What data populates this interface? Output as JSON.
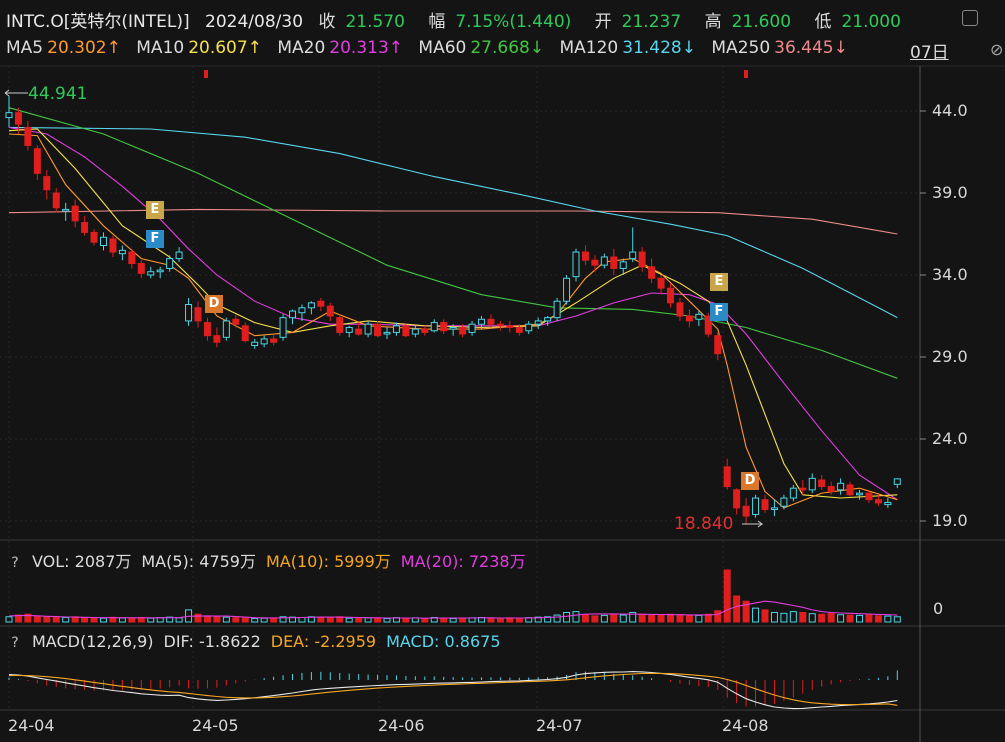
{
  "header": {
    "symbol": "INTC.O[英特尔(INTEL)]",
    "date": "2024/08/30",
    "close_label": "收",
    "close": "21.570",
    "change_label": "幅",
    "change": "7.15%(1.440)",
    "open_label": "开",
    "open": "21.237",
    "high_label": "高",
    "high": "21.600",
    "low_label": "低",
    "low": "21.000"
  },
  "ma_legend": [
    {
      "label": "MA5",
      "value": "20.302↑",
      "color": "#ff9a2e"
    },
    {
      "label": "MA10",
      "value": "20.607↑",
      "color": "#f5e14a"
    },
    {
      "label": "MA20",
      "value": "20.313↑",
      "color": "#e23de0"
    },
    {
      "label": "MA60",
      "value": "27.668↓",
      "color": "#41c741"
    },
    {
      "label": "MA120",
      "value": "31.428↓",
      "color": "#58d6ee"
    },
    {
      "label": "MA250",
      "value": "36.445↓",
      "color": "#f08a8a"
    }
  ],
  "period": "07日",
  "annotations": {
    "high_mark": "44.941",
    "low_mark": "18.840"
  },
  "volume_panel": {
    "q": "?",
    "vol": "VOL: 2087万",
    "ma5": "MA(5): 4759万",
    "ma10": "MA(10): 5999万",
    "ma20": "MA(20): 7238万",
    "zero_label": "0"
  },
  "macd_panel": {
    "q": "?",
    "title": "MACD(12,26,9)",
    "dif": "DIF: -1.8622",
    "dea": "DEA: -2.2959",
    "macd": "MACD: 0.8675"
  },
  "badges": [
    {
      "text": "E",
      "color": "#c9a64a"
    },
    {
      "text": "F",
      "color": "#2a8bc7"
    },
    {
      "text": "D",
      "color": "#d9782a"
    },
    {
      "text": "E",
      "color": "#c9a64a"
    },
    {
      "text": "F",
      "color": "#2a8bc7"
    },
    {
      "text": "D",
      "color": "#d9782a"
    }
  ],
  "chart_data": {
    "type": "candlestick",
    "x_tick_labels": [
      "24-04",
      "24-05",
      "24-06",
      "24-07",
      "24-08"
    ],
    "y_tick_labels": [
      "44.0",
      "39.0",
      "34.0",
      "29.0",
      "24.0",
      "19.0"
    ],
    "ylim": [
      18.3,
      46.0
    ],
    "colors": {
      "up": "#4ad6e6",
      "down": "#e01e1e",
      "volume_ma": "#e23de0"
    },
    "ohlc": [
      [
        43.6,
        44.94,
        43.0,
        43.9
      ],
      [
        43.9,
        44.2,
        42.6,
        43.2
      ],
      [
        43.0,
        43.4,
        41.6,
        41.9
      ],
      [
        41.7,
        41.9,
        39.8,
        40.2
      ],
      [
        40.0,
        40.4,
        38.6,
        39.2
      ],
      [
        39.0,
        39.3,
        37.8,
        38.1
      ],
      [
        37.9,
        38.4,
        37.3,
        38.0
      ],
      [
        38.2,
        38.6,
        36.9,
        37.3
      ],
      [
        37.2,
        37.6,
        36.4,
        36.6
      ],
      [
        36.6,
        36.8,
        35.8,
        36.0
      ],
      [
        35.8,
        36.6,
        35.5,
        36.3
      ],
      [
        36.2,
        36.4,
        35.1,
        35.4
      ],
      [
        35.3,
        35.8,
        34.9,
        35.5
      ],
      [
        35.4,
        35.6,
        34.4,
        34.7
      ],
      [
        34.7,
        34.9,
        33.8,
        34.1
      ],
      [
        34.0,
        34.5,
        33.8,
        34.2
      ],
      [
        34.2,
        34.5,
        33.8,
        34.3
      ],
      [
        34.4,
        35.2,
        34.2,
        35.0
      ],
      [
        35.0,
        35.7,
        34.8,
        35.4
      ],
      [
        31.2,
        32.6,
        30.9,
        32.2
      ],
      [
        32.0,
        32.4,
        30.8,
        31.2
      ],
      [
        31.1,
        31.4,
        30.0,
        30.3
      ],
      [
        30.3,
        30.8,
        29.6,
        29.9
      ],
      [
        30.2,
        31.4,
        30.0,
        31.2
      ],
      [
        31.3,
        31.6,
        30.8,
        31.0
      ],
      [
        30.9,
        31.1,
        29.9,
        30.0
      ],
      [
        29.7,
        30.1,
        29.5,
        29.9
      ],
      [
        29.8,
        30.3,
        29.6,
        30.1
      ],
      [
        30.1,
        30.4,
        29.7,
        29.9
      ],
      [
        30.2,
        31.6,
        30.0,
        31.4
      ],
      [
        31.4,
        31.9,
        31.0,
        31.8
      ],
      [
        31.7,
        32.2,
        31.2,
        32.0
      ],
      [
        32.0,
        32.4,
        31.6,
        32.3
      ],
      [
        32.4,
        32.6,
        31.8,
        32.1
      ],
      [
        32.1,
        32.3,
        31.2,
        31.5
      ],
      [
        31.4,
        31.6,
        30.3,
        30.5
      ],
      [
        30.5,
        30.9,
        30.2,
        30.8
      ],
      [
        30.7,
        31.1,
        30.3,
        30.4
      ],
      [
        30.4,
        31.2,
        30.2,
        31.0
      ],
      [
        31.0,
        31.2,
        30.2,
        30.3
      ],
      [
        30.4,
        30.8,
        30.1,
        30.5
      ],
      [
        30.5,
        31.1,
        30.3,
        30.9
      ],
      [
        30.9,
        31.0,
        30.2,
        30.3
      ],
      [
        30.4,
        30.9,
        30.2,
        30.7
      ],
      [
        30.7,
        30.9,
        30.3,
        30.5
      ],
      [
        30.6,
        31.3,
        30.5,
        31.1
      ],
      [
        31.1,
        31.3,
        30.4,
        30.6
      ],
      [
        30.7,
        31.0,
        30.3,
        30.8
      ],
      [
        30.8,
        31.0,
        30.2,
        30.4
      ],
      [
        30.5,
        31.2,
        30.3,
        31.0
      ],
      [
        31.0,
        31.5,
        30.7,
        31.3
      ],
      [
        31.3,
        31.6,
        30.8,
        31.0
      ],
      [
        31.0,
        31.2,
        30.6,
        30.9
      ],
      [
        30.9,
        31.2,
        30.5,
        30.8
      ],
      [
        30.8,
        31.0,
        30.3,
        30.5
      ],
      [
        30.6,
        31.2,
        30.4,
        31.0
      ],
      [
        31.0,
        31.4,
        30.7,
        31.2
      ],
      [
        31.2,
        31.5,
        30.9,
        31.4
      ],
      [
        31.4,
        32.6,
        31.2,
        32.4
      ],
      [
        32.4,
        34.0,
        32.2,
        33.8
      ],
      [
        33.9,
        35.6,
        33.6,
        35.4
      ],
      [
        35.4,
        35.8,
        34.6,
        34.9
      ],
      [
        34.9,
        35.2,
        34.2,
        34.6
      ],
      [
        34.6,
        35.3,
        34.4,
        35.1
      ],
      [
        35.1,
        35.6,
        34.0,
        34.4
      ],
      [
        34.4,
        35.0,
        34.0,
        34.8
      ],
      [
        35.0,
        36.9,
        34.8,
        35.4
      ],
      [
        35.4,
        35.7,
        34.2,
        34.5
      ],
      [
        34.5,
        35.0,
        33.5,
        33.8
      ],
      [
        33.8,
        34.0,
        32.8,
        33.2
      ],
      [
        33.2,
        33.5,
        32.0,
        32.3
      ],
      [
        32.3,
        32.6,
        31.2,
        31.5
      ],
      [
        31.5,
        31.9,
        30.8,
        31.2
      ],
      [
        31.3,
        31.8,
        30.9,
        31.6
      ],
      [
        31.5,
        31.7,
        30.2,
        30.4
      ],
      [
        30.3,
        30.5,
        28.8,
        29.2
      ],
      [
        22.3,
        22.8,
        20.9,
        21.1
      ],
      [
        20.9,
        21.0,
        19.4,
        19.8
      ],
      [
        19.9,
        20.4,
        18.84,
        19.3
      ],
      [
        19.4,
        20.6,
        19.2,
        20.4
      ],
      [
        20.3,
        20.6,
        19.5,
        19.7
      ],
      [
        19.7,
        20.3,
        19.3,
        19.8
      ],
      [
        19.9,
        20.6,
        19.7,
        20.4
      ],
      [
        20.4,
        21.2,
        20.2,
        21.0
      ],
      [
        21.0,
        21.5,
        20.6,
        20.9
      ],
      [
        20.9,
        21.9,
        20.7,
        21.6
      ],
      [
        21.5,
        21.8,
        20.9,
        21.1
      ],
      [
        21.1,
        21.4,
        20.6,
        20.8
      ],
      [
        20.9,
        21.6,
        20.6,
        21.3
      ],
      [
        21.2,
        21.4,
        20.5,
        20.6
      ],
      [
        20.6,
        20.9,
        20.3,
        20.7
      ],
      [
        20.7,
        20.9,
        20.1,
        20.3
      ],
      [
        20.3,
        20.6,
        19.9,
        20.1
      ],
      [
        20.0,
        20.4,
        19.8,
        20.13
      ],
      [
        21.237,
        21.6,
        21.0,
        21.57
      ]
    ],
    "volume_scale": [
      0,
      300
    ],
    "volumes": [
      30,
      40,
      45,
      35,
      30,
      28,
      26,
      30,
      25,
      24,
      22,
      27,
      23,
      24,
      26,
      22,
      25,
      28,
      24,
      70,
      45,
      35,
      30,
      28,
      25,
      22,
      20,
      22,
      24,
      30,
      28,
      26,
      30,
      25,
      28,
      30,
      22,
      20,
      24,
      22,
      20,
      25,
      22,
      24,
      20,
      26,
      22,
      20,
      22,
      24,
      26,
      22,
      20,
      24,
      22,
      25,
      28,
      30,
      40,
      55,
      60,
      42,
      35,
      38,
      45,
      40,
      55,
      42,
      38,
      40,
      45,
      42,
      35,
      38,
      45,
      65,
      300,
      150,
      120,
      80,
      70,
      55,
      50,
      60,
      55,
      48,
      45,
      50,
      42,
      40,
      38,
      42,
      36,
      34,
      30
    ],
    "volume_ma": [
      35,
      37,
      38,
      36,
      33,
      31,
      29,
      28,
      27,
      26,
      25,
      25,
      25,
      24,
      24,
      24,
      24,
      25,
      25,
      33,
      34,
      35,
      34,
      34,
      31,
      28,
      25,
      24,
      23,
      24,
      25,
      26,
      27,
      28,
      28,
      28,
      27,
      26,
      25,
      24,
      23,
      23,
      23,
      23,
      22,
      23,
      23,
      23,
      23,
      23,
      24,
      24,
      23,
      23,
      23,
      23,
      24,
      26,
      29,
      33,
      40,
      45,
      47,
      47,
      47,
      46,
      45,
      45,
      44,
      43,
      42,
      42,
      41,
      41,
      41,
      43,
      70,
      90,
      100,
      110,
      120,
      115,
      105,
      95,
      85,
      70,
      60,
      55,
      52,
      50,
      48,
      46,
      44,
      42,
      40
    ],
    "macd": {
      "dif": [
        0.5,
        0.45,
        0.35,
        0.2,
        0.05,
        -0.1,
        -0.25,
        -0.4,
        -0.55,
        -0.7,
        -0.82,
        -0.95,
        -1.05,
        -1.15,
        -1.25,
        -1.32,
        -1.38,
        -1.4,
        -1.38,
        -1.6,
        -1.72,
        -1.8,
        -1.85,
        -1.82,
        -1.76,
        -1.7,
        -1.62,
        -1.52,
        -1.42,
        -1.3,
        -1.18,
        -1.05,
        -0.92,
        -0.82,
        -0.75,
        -0.7,
        -0.65,
        -0.6,
        -0.55,
        -0.5,
        -0.46,
        -0.42,
        -0.4,
        -0.37,
        -0.34,
        -0.3,
        -0.28,
        -0.26,
        -0.24,
        -0.22,
        -0.18,
        -0.15,
        -0.12,
        -0.1,
        -0.08,
        -0.04,
        0.0,
        0.05,
        0.12,
        0.25,
        0.45,
        0.58,
        0.65,
        0.7,
        0.72,
        0.73,
        0.76,
        0.74,
        0.68,
        0.6,
        0.5,
        0.38,
        0.25,
        0.15,
        0.02,
        -0.2,
        -0.75,
        -1.25,
        -1.7,
        -2.0,
        -2.25,
        -2.45,
        -2.55,
        -2.6,
        -2.58,
        -2.52,
        -2.45,
        -2.4,
        -2.33,
        -2.28,
        -2.22,
        -2.17,
        -2.1,
        -2.0,
        -1.8622
      ],
      "dea": [
        0.4,
        0.41,
        0.4,
        0.36,
        0.3,
        0.22,
        0.13,
        0.02,
        -0.1,
        -0.22,
        -0.34,
        -0.46,
        -0.58,
        -0.69,
        -0.8,
        -0.9,
        -0.99,
        -1.07,
        -1.13,
        -1.22,
        -1.32,
        -1.42,
        -1.5,
        -1.57,
        -1.61,
        -1.63,
        -1.63,
        -1.61,
        -1.57,
        -1.52,
        -1.45,
        -1.37,
        -1.28,
        -1.19,
        -1.1,
        -1.02,
        -0.94,
        -0.87,
        -0.8,
        -0.74,
        -0.68,
        -0.63,
        -0.58,
        -0.54,
        -0.5,
        -0.46,
        -0.42,
        -0.39,
        -0.36,
        -0.33,
        -0.3,
        -0.27,
        -0.24,
        -0.21,
        -0.18,
        -0.15,
        -0.12,
        -0.08,
        -0.04,
        0.02,
        0.1,
        0.2,
        0.29,
        0.37,
        0.44,
        0.5,
        0.55,
        0.59,
        0.6,
        0.6,
        0.58,
        0.54,
        0.48,
        0.42,
        0.34,
        0.24,
        0.05,
        -0.2,
        -0.5,
        -0.8,
        -1.09,
        -1.36,
        -1.6,
        -1.8,
        -1.96,
        -2.07,
        -2.15,
        -2.2,
        -2.23,
        -2.24,
        -2.24,
        -2.23,
        -2.2,
        -2.17,
        -2.2959
      ]
    },
    "ma_series_approx": {
      "ma5": [
        [
          0,
          42.6
        ],
        [
          3,
          42.5
        ],
        [
          6,
          39.5
        ],
        [
          10,
          37.0
        ],
        [
          14,
          35.0
        ],
        [
          17,
          34.6
        ],
        [
          19,
          33.8
        ],
        [
          22,
          31.5
        ],
        [
          26,
          30.3
        ],
        [
          30,
          30.5
        ],
        [
          34,
          31.8
        ],
        [
          38,
          30.9
        ],
        [
          44,
          30.7
        ],
        [
          50,
          30.7
        ],
        [
          56,
          31.0
        ],
        [
          58,
          31.6
        ],
        [
          61,
          33.8
        ],
        [
          63,
          34.8
        ],
        [
          66,
          35.0
        ],
        [
          69,
          34.1
        ],
        [
          72,
          32.4
        ],
        [
          75,
          30.7
        ],
        [
          76,
          28.5
        ],
        [
          78,
          23.5
        ],
        [
          80,
          20.8
        ],
        [
          82,
          19.8
        ],
        [
          86,
          20.7
        ],
        [
          90,
          21.0
        ],
        [
          94,
          20.3
        ]
      ],
      "ma10": [
        [
          0,
          42.8
        ],
        [
          3,
          42.9
        ],
        [
          7,
          40.5
        ],
        [
          12,
          37.0
        ],
        [
          17,
          35.1
        ],
        [
          20,
          33.4
        ],
        [
          22,
          32.2
        ],
        [
          26,
          31.1
        ],
        [
          30,
          30.5
        ],
        [
          34,
          30.9
        ],
        [
          38,
          31.2
        ],
        [
          44,
          30.9
        ],
        [
          50,
          30.8
        ],
        [
          56,
          30.9
        ],
        [
          60,
          32.3
        ],
        [
          64,
          33.8
        ],
        [
          67,
          34.6
        ],
        [
          71,
          33.5
        ],
        [
          74,
          32.4
        ],
        [
          76,
          31.2
        ],
        [
          78,
          28.5
        ],
        [
          80,
          25.5
        ],
        [
          82,
          22.5
        ],
        [
          84,
          20.6
        ],
        [
          88,
          20.4
        ],
        [
          94,
          20.6
        ]
      ],
      "ma20": [
        [
          0,
          43.0
        ],
        [
          4,
          42.6
        ],
        [
          8,
          41.2
        ],
        [
          12,
          39.4
        ],
        [
          16,
          37.4
        ],
        [
          19,
          35.6
        ],
        [
          22,
          34.0
        ],
        [
          26,
          32.4
        ],
        [
          30,
          31.4
        ],
        [
          34,
          31.0
        ],
        [
          38,
          31.0
        ],
        [
          44,
          30.9
        ],
        [
          50,
          30.9
        ],
        [
          56,
          30.9
        ],
        [
          60,
          31.5
        ],
        [
          64,
          32.3
        ],
        [
          68,
          32.9
        ],
        [
          72,
          32.8
        ],
        [
          75,
          32.2
        ],
        [
          78,
          30.4
        ],
        [
          82,
          27.4
        ],
        [
          86,
          24.5
        ],
        [
          90,
          21.8
        ],
        [
          94,
          20.3
        ]
      ],
      "ma60": [
        [
          0,
          44.2
        ],
        [
          10,
          42.6
        ],
        [
          20,
          40.2
        ],
        [
          30,
          37.4
        ],
        [
          40,
          34.6
        ],
        [
          50,
          32.8
        ],
        [
          58,
          32.0
        ],
        [
          66,
          31.9
        ],
        [
          72,
          31.5
        ],
        [
          78,
          30.8
        ],
        [
          86,
          29.4
        ],
        [
          94,
          27.7
        ]
      ],
      "ma120": [
        [
          0,
          43.0
        ],
        [
          15,
          42.9
        ],
        [
          25,
          42.4
        ],
        [
          35,
          41.4
        ],
        [
          45,
          40.0
        ],
        [
          55,
          38.8
        ],
        [
          62,
          37.9
        ],
        [
          70,
          37.1
        ],
        [
          76,
          36.4
        ],
        [
          84,
          34.4
        ],
        [
          94,
          31.4
        ]
      ],
      "ma250": [
        [
          0,
          37.8
        ],
        [
          20,
          38.0
        ],
        [
          40,
          37.9
        ],
        [
          60,
          37.9
        ],
        [
          75,
          37.8
        ],
        [
          85,
          37.4
        ],
        [
          94,
          36.5
        ]
      ]
    }
  }
}
